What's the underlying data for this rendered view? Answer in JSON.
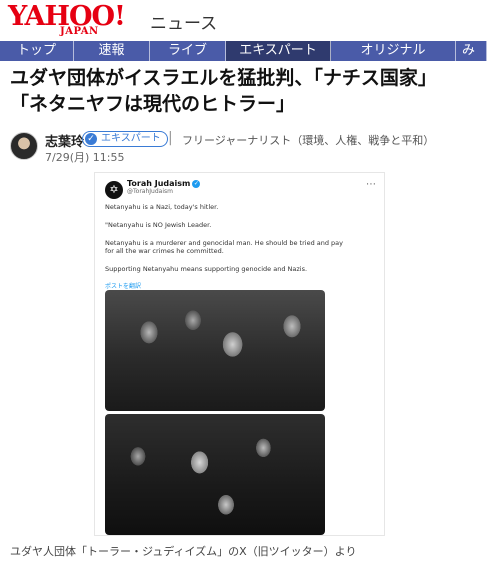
{
  "header": {
    "logo_main": "YAHOO!",
    "logo_sub": "JAPAN",
    "service_name": "ニュース"
  },
  "nav": {
    "items": [
      {
        "label": "トップ",
        "active": false
      },
      {
        "label": "速報",
        "active": false
      },
      {
        "label": "ライブ",
        "active": false
      },
      {
        "label": "エキスパート",
        "active": true
      },
      {
        "label": "オリジナル",
        "active": false
      },
      {
        "label": "み",
        "active": false
      }
    ]
  },
  "article": {
    "title_line1": "ユダヤ団体がイスラエルを猛批判、「ナチス国家」",
    "title_line2": "「ネタニヤフは現代のヒトラー」",
    "author_name": "志葉玲",
    "badge_label": "エキスパート",
    "author_description": "フリージャーナリスト（環境、人権、戦争と平和）",
    "date": "7/29(月) 11:55",
    "caption": "ユダヤ人団体「トーラー・ジュディイズム」のX（旧ツイッター）より"
  },
  "tweet": {
    "display_name": "Torah Judaism",
    "handle": "@TorahJudaism",
    "lines": [
      "Netanyahu is a Nazi, today's hitler.",
      "\"Netanyahu is NO Jewish Leader.",
      "Netanyahu is a murderer and genocidal man. He should be tried and pay",
      "for all the war crimes he committed.",
      "Supporting Netanyahu means supporting genocide and Nazis."
    ],
    "translate_label": "ポストを翻訳"
  },
  "icons": {
    "badge": "check-icon",
    "menu": "more-icon",
    "verified": "verified-icon"
  },
  "colors": {
    "brand": "#e60012",
    "nav_bg": "#4a5ba8",
    "nav_active": "#2f3a6e",
    "link_blue": "#1d9bf0"
  }
}
